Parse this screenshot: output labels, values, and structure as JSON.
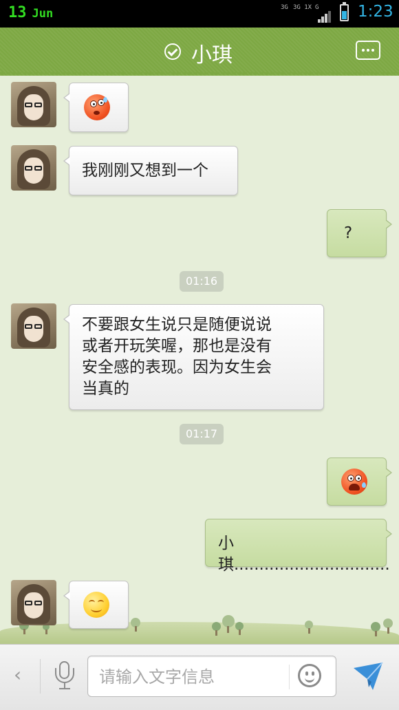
{
  "status_bar": {
    "date_day": "13",
    "date_month": "Jun",
    "network_label_1": "3G",
    "network_label_2": "3G 1X",
    "network_label_3": "G",
    "time": "1:23"
  },
  "header": {
    "contact_name": "小琪",
    "status_icon": "check-circle-icon",
    "menu_icon": "more-menu-icon"
  },
  "messages": [
    {
      "side": "incoming",
      "type": "emoji",
      "emoji": "sweat-face-emoji"
    },
    {
      "side": "incoming",
      "type": "text",
      "text": "我刚刚又想到一个"
    },
    {
      "side": "outgoing",
      "type": "text",
      "text": "?"
    },
    {
      "side": "system",
      "type": "time",
      "text": "01:16"
    },
    {
      "side": "incoming",
      "type": "text",
      "lines": [
        "不要跟女生说只是随便说说",
        "或者开玩笑喔，那也是没有",
        "安全感的表现。因为女生会",
        "当真的"
      ]
    },
    {
      "side": "system",
      "type": "time",
      "text": "01:17"
    },
    {
      "side": "outgoing",
      "type": "emoji",
      "emoji": "sad-sweat-face-emoji"
    },
    {
      "side": "outgoing",
      "type": "text",
      "text": "小琪..............................."
    },
    {
      "side": "incoming",
      "type": "emoji",
      "emoji": "smile-face-emoji"
    }
  ],
  "input_bar": {
    "back_icon": "chevron-left-icon",
    "voice_icon": "microphone-icon",
    "placeholder": "请输入文字信息",
    "value": "",
    "emoji_icon": "smiley-icon",
    "send_icon": "send-icon"
  },
  "colors": {
    "header_green": "#7da843",
    "chat_background": "#e6eed9",
    "outgoing_bubble": "#d3e4b6",
    "incoming_bubble": "#ffffff",
    "status_time": "#33b5e5",
    "status_date": "#33dd22",
    "send_blue": "#3a8fd8"
  }
}
